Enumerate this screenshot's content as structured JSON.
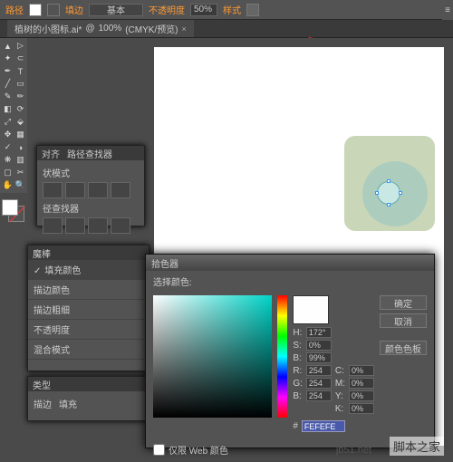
{
  "topbar": {
    "label_path": "路径",
    "label_fill": "填边",
    "stroke_style": "基本",
    "label_opacity": "不透明度",
    "opacity_value": "50%",
    "label_style": "样式"
  },
  "tab": {
    "filename": "植树的小图标.ai*",
    "zoom": "100%",
    "colormode": "(CMYK/预览)"
  },
  "pathfinder": {
    "tab1": "对齐",
    "tab2": "路径查找器",
    "section1": "状模式",
    "section2": "径查找器"
  },
  "fillpanel": {
    "tab": "魔棒",
    "items": [
      "填充颜色",
      "描边颜色",
      "描边粗细",
      "不透明度",
      "混合模式"
    ]
  },
  "typepanel": {
    "label": "类型",
    "sub1": "描边",
    "sub2": "填充"
  },
  "picker": {
    "title": "拾色器",
    "select_label": "选择颜色:",
    "btn_ok": "确定",
    "btn_cancel": "取消",
    "btn_swatches": "颜色色板",
    "H": "172°",
    "S": "0%",
    "B": "99%",
    "R": "254",
    "G": "254",
    "Bl": "254",
    "C": "0%",
    "M": "0%",
    "Y": "0%",
    "K": "0%",
    "hex": "FEFEFE",
    "webonly": "仅限 Web 颜色"
  },
  "watermark": {
    "site": "脚本之家",
    "url": "jb51.net"
  }
}
